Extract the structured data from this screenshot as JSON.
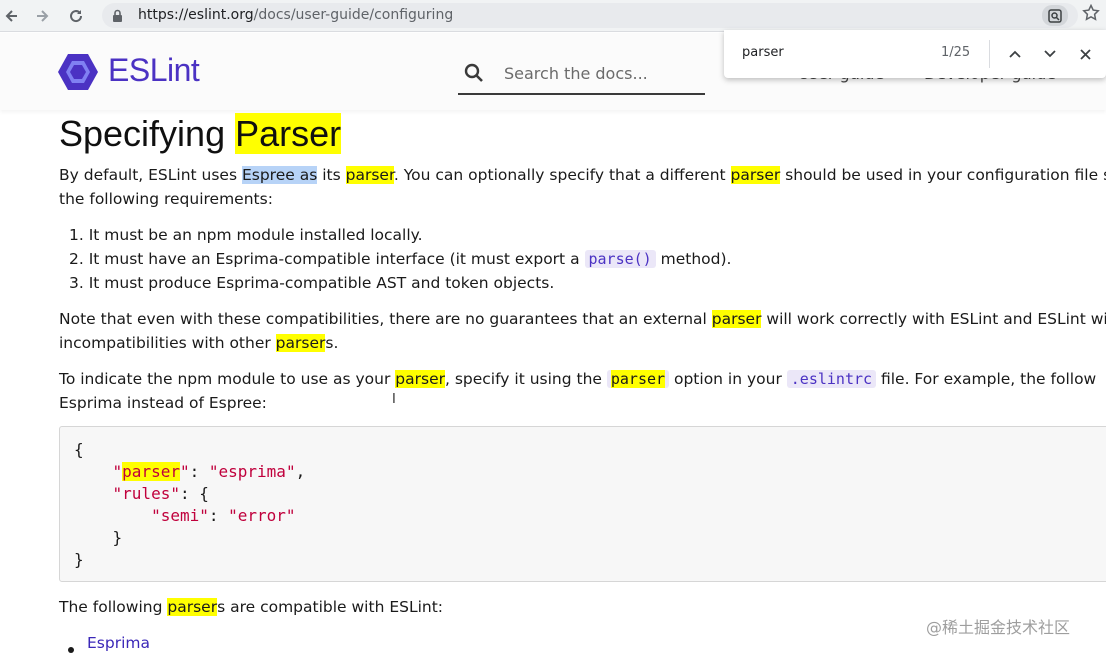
{
  "browser": {
    "url_host": "https://eslint.org",
    "url_path": "/docs/user-guide/configuring"
  },
  "find_bar": {
    "query": "parser",
    "count": "1/25"
  },
  "site": {
    "logo_text": "ESLint",
    "search_placeholder": "Search the docs...",
    "nav": [
      "User guide",
      "Developer guide"
    ],
    "accent_color": "#4b32c3"
  },
  "article": {
    "heading_a": "Specifying ",
    "heading_b": "Parser",
    "p1_a": "By default, ESLint uses ",
    "p1_sel": "Espree as",
    "p1_b": " its ",
    "p1_hl1": "parser",
    "p1_c": ". You can optionally specify that a different ",
    "p1_hl2": "parser",
    "p1_d": " should be used in your configuration file so",
    "p1_line2": "the following requirements:",
    "li1": "1. It must be an npm module installed locally.",
    "li2_a": "2. It must have an Esprima-compatible interface (it must export a ",
    "li2_code": "parse()",
    "li2_b": " method).",
    "li3": "3. It must produce Esprima-compatible AST and token objects.",
    "p2_a": "Note that even with these compatibilities, there are no guarantees that an external ",
    "p2_hl": "parser",
    "p2_b": " will work correctly with ESLint and ESLint wil",
    "p2_line2_a": "incompatibilities with other ",
    "p2_line2_hl": "parser",
    "p2_line2_b": "s.",
    "p3_a": "To indicate the npm module to use as your ",
    "p3_hl": "parser",
    "p3_b": ", specify it using the ",
    "p3_code1": "parser",
    "p3_c": " option in your ",
    "p3_code2": ".eslintrc",
    "p3_d": " file. For example, the follow",
    "p3_line2": "Esprima instead of Espree:",
    "code": {
      "l1": "{",
      "l2_indent": "    ",
      "l2_q1": "\"",
      "l2_key": "parser",
      "l2_q2": "\"",
      "l2_colon": ": ",
      "l2_val": "\"esprima\"",
      "l2_comma": ",",
      "l3_indent": "    ",
      "l3_key": "\"rules\"",
      "l3_rest": ": {",
      "l4_indent": "        ",
      "l4_key": "\"semi\"",
      "l4_colon": ": ",
      "l4_val": "\"error\"",
      "l5": "    }",
      "l6": "}"
    },
    "p4_a": "The following ",
    "p4_hl": "parser",
    "p4_b": "s are compatible with ESLint:",
    "list_link": "Esprima"
  },
  "watermark": "@稀土掘金技术社区"
}
